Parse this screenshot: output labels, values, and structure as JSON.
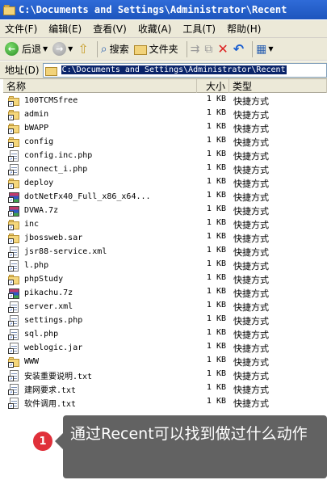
{
  "window": {
    "title": "C:\\Documents and Settings\\Administrator\\Recent"
  },
  "menu": [
    "文件(F)",
    "编辑(E)",
    "查看(V)",
    "收藏(A)",
    "工具(T)",
    "帮助(H)"
  ],
  "toolbar": {
    "back_label": "后退",
    "search_label": "搜索",
    "folders_label": "文件夹"
  },
  "address": {
    "label": "地址(D)",
    "value": "C:\\Documents and Settings\\Administrator\\Recent"
  },
  "columns": {
    "name": "名称",
    "size": "大小",
    "type": "类型"
  },
  "files": [
    {
      "name": "100TCMSfree",
      "size": "1 KB",
      "type": "快捷方式",
      "icon": "folder"
    },
    {
      "name": "admin",
      "size": "1 KB",
      "type": "快捷方式",
      "icon": "folder"
    },
    {
      "name": "bWAPP",
      "size": "1 KB",
      "type": "快捷方式",
      "icon": "folder"
    },
    {
      "name": "config",
      "size": "1 KB",
      "type": "快捷方式",
      "icon": "folder"
    },
    {
      "name": "config.inc.php",
      "size": "1 KB",
      "type": "快捷方式",
      "icon": "doc"
    },
    {
      "name": "connect_i.php",
      "size": "1 KB",
      "type": "快捷方式",
      "icon": "doc"
    },
    {
      "name": "deploy",
      "size": "1 KB",
      "type": "快捷方式",
      "icon": "folder"
    },
    {
      "name": "dotNetFx40_Full_x86_x64...",
      "size": "1 KB",
      "type": "快捷方式",
      "icon": "archive"
    },
    {
      "name": "DVWA.7z",
      "size": "1 KB",
      "type": "快捷方式",
      "icon": "archive"
    },
    {
      "name": "inc",
      "size": "1 KB",
      "type": "快捷方式",
      "icon": "folder"
    },
    {
      "name": "jbossweb.sar",
      "size": "1 KB",
      "type": "快捷方式",
      "icon": "folder"
    },
    {
      "name": "jsr88-service.xml",
      "size": "1 KB",
      "type": "快捷方式",
      "icon": "doc"
    },
    {
      "name": "l.php",
      "size": "1 KB",
      "type": "快捷方式",
      "icon": "doc"
    },
    {
      "name": "phpStudy",
      "size": "1 KB",
      "type": "快捷方式",
      "icon": "folder"
    },
    {
      "name": "pikachu.7z",
      "size": "1 KB",
      "type": "快捷方式",
      "icon": "archive"
    },
    {
      "name": "server.xml",
      "size": "1 KB",
      "type": "快捷方式",
      "icon": "doc"
    },
    {
      "name": "settings.php",
      "size": "1 KB",
      "type": "快捷方式",
      "icon": "doc"
    },
    {
      "name": "sql.php",
      "size": "1 KB",
      "type": "快捷方式",
      "icon": "doc"
    },
    {
      "name": "weblogic.jar",
      "size": "1 KB",
      "type": "快捷方式",
      "icon": "doc"
    },
    {
      "name": "WWW",
      "size": "1 KB",
      "type": "快捷方式",
      "icon": "folder"
    },
    {
      "name": "安装重要说明.txt",
      "size": "1 KB",
      "type": "快捷方式",
      "icon": "doc"
    },
    {
      "name": "建网要求.txt",
      "size": "1 KB",
      "type": "快捷方式",
      "icon": "doc"
    },
    {
      "name": "软件调用.txt",
      "size": "1 KB",
      "type": "快捷方式",
      "icon": "doc"
    }
  ],
  "callout": {
    "number": "1",
    "text": "通过Recent可以找到做过什么动作"
  }
}
